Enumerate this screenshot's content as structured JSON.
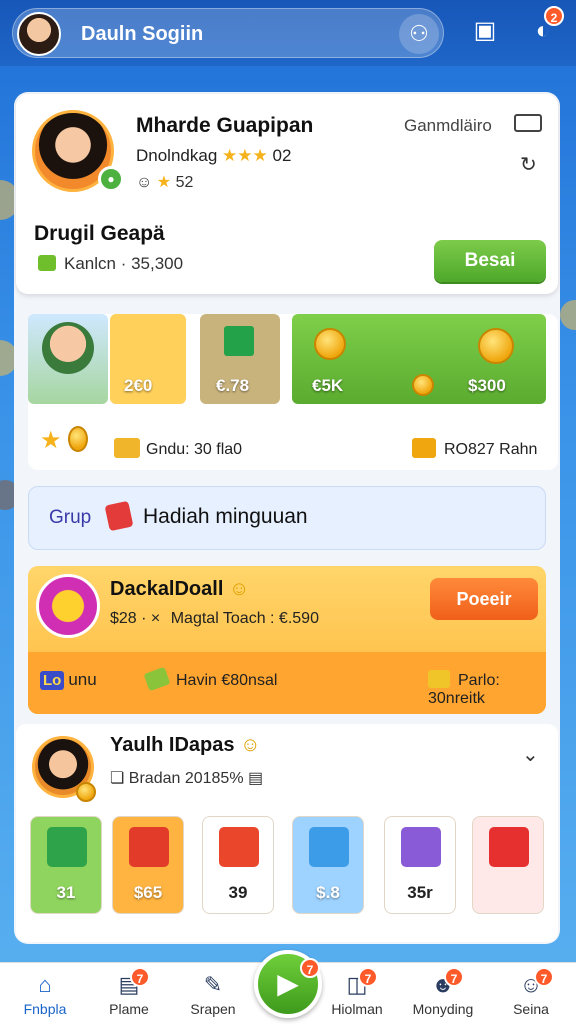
{
  "topbar": {
    "name": "Dauln Sogiin",
    "badge_count": "2"
  },
  "profile": {
    "name": "Mharde Guapipan",
    "subtitle": "Dnolndkag",
    "stars_value": "02",
    "stars_small": "52",
    "right_label": "Ganmdläiro",
    "group_title": "Drugil Geapä",
    "group_info": "Kanlcn · 35,300",
    "action_label": "Besai"
  },
  "rewards": {
    "tiles": [
      {
        "label": "2€0"
      },
      {
        "label": "€.78"
      },
      {
        "label": "€5K"
      },
      {
        "label": "$300"
      }
    ],
    "info_left": "Gndu: 30 fla0",
    "info_right": "RO827 Rahn"
  },
  "banner": {
    "prefix": "Grup",
    "text": "Hadiah minguuan"
  },
  "deal": {
    "title": "DackalDoall",
    "sub_left": "$28 · ×",
    "sub_right": "Magtal Toach : €.590",
    "action_label": "Poeeir",
    "tag": "Lo",
    "bottom_left": "unu",
    "bottom_mid": "Havin €80nsal",
    "bottom_right": "Parlo: 30nreitk"
  },
  "user": {
    "name": "Yaulh IDapas",
    "subtitle": "Bradan 20185%",
    "gifts": [
      {
        "label": "31",
        "color": "#8fd45e",
        "box": "#2fa34a"
      },
      {
        "label": "$65",
        "color": "#ffb441",
        "box": "#e23b2a"
      },
      {
        "label": "39",
        "color": "#ffffff",
        "box": "#e9462c"
      },
      {
        "label": "$.8",
        "color": "#9ed3ff",
        "box": "#3d9ce8"
      },
      {
        "label": "35r",
        "color": "#ffffff",
        "box": "#8a5bd6"
      },
      {
        "label": "",
        "color": "#ffe8e8",
        "box": "#e63030"
      }
    ]
  },
  "nav": {
    "items": [
      {
        "label": "Fnbpla"
      },
      {
        "label": "Plame"
      },
      {
        "label": "Srapen"
      },
      {
        "label": "Hiolman"
      },
      {
        "label": "Monyding"
      },
      {
        "label": "Seina"
      }
    ],
    "center_badge": "7",
    "badges": [
      "7",
      "7",
      "7",
      "7"
    ]
  }
}
